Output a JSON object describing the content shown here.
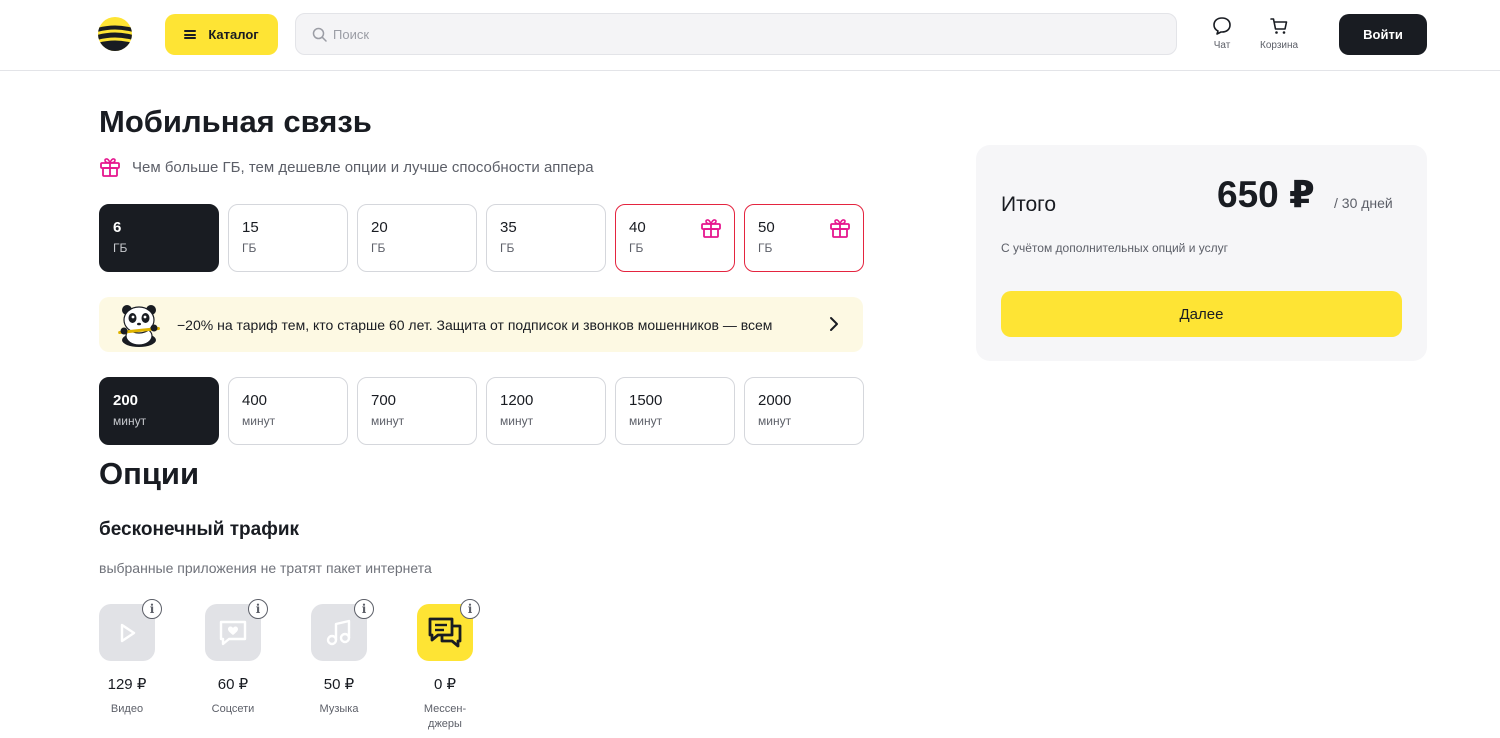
{
  "header": {
    "catalog_label": "Каталог",
    "search_placeholder": "Поиск",
    "chat_label": "Чат",
    "cart_label": "Корзина",
    "login_label": "Войти",
    "brand_yellow": "#fee434",
    "brand_dark": "#191c22"
  },
  "main": {
    "title": "Мобильная связь",
    "promo_text": "Чем больше ГБ, тем дешевле опции и лучше способности аппера",
    "gb_options": [
      {
        "value": "6",
        "unit": "ГБ",
        "selected": true,
        "gift": false
      },
      {
        "value": "15",
        "unit": "ГБ",
        "selected": false,
        "gift": false
      },
      {
        "value": "20",
        "unit": "ГБ",
        "selected": false,
        "gift": false
      },
      {
        "value": "35",
        "unit": "ГБ",
        "selected": false,
        "gift": false
      },
      {
        "value": "40",
        "unit": "ГБ",
        "selected": false,
        "gift": true
      },
      {
        "value": "50",
        "unit": "ГБ",
        "selected": false,
        "gift": true
      }
    ],
    "banner_text": "−20% на тариф тем, кто старше 60 лет. Защита от подписок и звонков мошенников — всем",
    "minute_options": [
      {
        "value": "200",
        "unit": "минут",
        "selected": true
      },
      {
        "value": "400",
        "unit": "минут",
        "selected": false
      },
      {
        "value": "700",
        "unit": "минут",
        "selected": false
      },
      {
        "value": "1200",
        "unit": "минут",
        "selected": false
      },
      {
        "value": "1500",
        "unit": "минут",
        "selected": false
      },
      {
        "value": "2000",
        "unit": "минут",
        "selected": false
      }
    ]
  },
  "options": {
    "title": "Опции",
    "subtitle": "бесконечный трафик",
    "description": "выбранные приложения не тратят пакет интернета",
    "items": [
      {
        "icon": "play-icon",
        "price": "129 ₽",
        "name": "Видео",
        "active": false
      },
      {
        "icon": "heart-chat-icon",
        "price": "60 ₽",
        "name": "Соцсети",
        "active": false
      },
      {
        "icon": "music-note-icon",
        "price": "50 ₽",
        "name": "Музыка",
        "active": false
      },
      {
        "icon": "messages-icon",
        "price": "0 ₽",
        "name": "Мессен-\nджеры",
        "active": true
      }
    ]
  },
  "summary": {
    "label": "Итого",
    "price": "650 ₽",
    "period": "/ 30 дней",
    "note": "С учётом дополнительных опций и услуг",
    "next_label": "Далее"
  }
}
